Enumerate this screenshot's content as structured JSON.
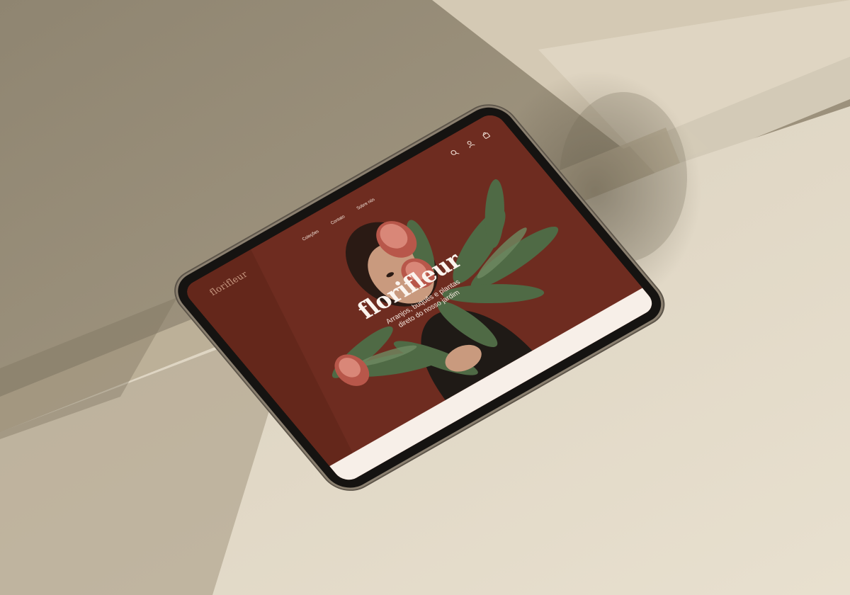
{
  "brand": {
    "logo": "florifleur"
  },
  "nav": {
    "links": [
      "Coleções",
      "Contato",
      "Sobre nós"
    ],
    "icons": [
      "search-icon",
      "user-icon",
      "cart-icon"
    ]
  },
  "hero": {
    "title": "florifleur",
    "subtitle_line1": "Arranjos, buquês e plantas",
    "subtitle_line2": "direto do nosso jardim"
  },
  "colors": {
    "hero_background": "#6e2c20",
    "leaf_green": "#4f6a45",
    "protea_red": "#b8574a",
    "lower_section": "#f7efe8",
    "stone_background": "#bfb29b"
  }
}
